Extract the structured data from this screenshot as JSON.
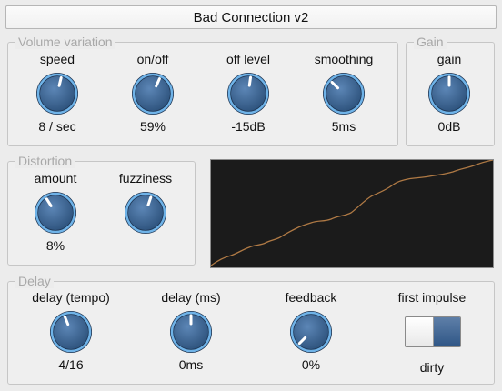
{
  "title": "Bad Connection v2",
  "groups": {
    "volume": "Volume variation",
    "gain": "Gain",
    "distortion": "Distortion",
    "delay": "Delay"
  },
  "volume": {
    "speed": {
      "label": "speed",
      "value": "8 / sec",
      "level": 0.55
    },
    "onoff": {
      "label": "on/off",
      "value": "59%",
      "level": 0.59
    },
    "off_level": {
      "label": "off level",
      "value": "-15dB",
      "level": 0.53
    },
    "smoothing": {
      "label": "smoothing",
      "value": "5ms",
      "level": 0.33
    }
  },
  "gain": {
    "gain": {
      "label": "gain",
      "value": "0dB",
      "level": 0.5
    }
  },
  "distortion": {
    "amount": {
      "label": "amount",
      "value": "8%",
      "level": 0.38
    },
    "fuzziness": {
      "label": "fuzziness",
      "value": "",
      "level": 0.57
    }
  },
  "delay": {
    "tempo": {
      "label": "delay (tempo)",
      "value": "4/16",
      "level": 0.42
    },
    "ms": {
      "label": "delay (ms)",
      "value": "0ms",
      "level": 0.5
    },
    "feedback": {
      "label": "feedback",
      "value": "0%",
      "level": 0.0
    },
    "first_impulse": {
      "label": "first impulse",
      "value": "dirty",
      "on": true
    }
  },
  "colors": {
    "knob_body": "#2d527c",
    "knob_ring": "#6fb3e8",
    "graph_bg": "#1b1b1b",
    "graph_line": "#b07a45",
    "toggle_on": "#3d6493"
  }
}
